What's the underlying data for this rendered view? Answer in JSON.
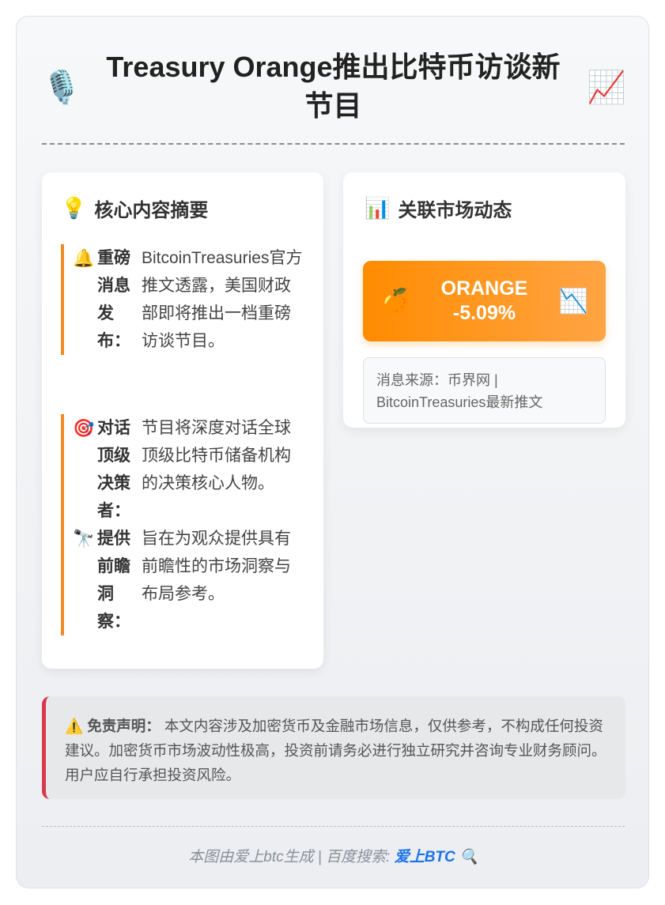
{
  "header": {
    "left_icon": "microphone-icon",
    "left_glyph": "🎙️",
    "title": "Treasury Orange推出比特币访谈新节目",
    "right_icon": "chart-increasing-icon",
    "right_glyph": "📈"
  },
  "summary": {
    "icon": "lightbulb-icon",
    "glyph": "💡",
    "heading": "核心内容摘要",
    "points": [
      {
        "icon": "bell-icon",
        "glyph": "🔔",
        "label": "重磅消息发布：",
        "text": "BitcoinTreasuries官方推文透露，美国财政部即将推出一档重磅访谈节目。"
      },
      {
        "icon": "target-icon",
        "glyph": "🎯",
        "label": "对话顶级决策者：",
        "text": "节目将深度对话全球顶级比特币储备机构的决策核心人物。"
      },
      {
        "icon": "telescope-icon",
        "glyph": "🔭",
        "label": "提供前瞻洞察：",
        "text": "旨在为观众提供具有前瞻性的市场洞察与布局参考。"
      }
    ]
  },
  "market": {
    "icon": "bar-chart-icon",
    "glyph": "📊",
    "heading": "关联市场动态",
    "ticker": {
      "left_icon": "orange-icon",
      "left_glyph": "🍊",
      "symbol": "ORANGE",
      "change": "-5.09%",
      "right_icon": "chart-decreasing-icon",
      "right_glyph": "📉"
    },
    "source": "消息来源：币界网 | BitcoinTreasuries最新推文"
  },
  "disclaimer": {
    "icon": "warning-icon",
    "glyph": "⚠️",
    "label": "免责声明：",
    "text": "本文内容涉及加密货币及金融市场信息，仅供参考，不构成任何投资建议。加密货币市场波动性极高，投资前请务必进行独立研究并咨询专业财务顾问。用户应自行承担投资风险。"
  },
  "footer": {
    "prefix": "本图由爱上btc生成 | 百度搜索: ",
    "brand": "爱上BTC",
    "icon": "magnifier-icon",
    "glyph": "🔍"
  },
  "colors": {
    "accent": "#f08a24",
    "ticker_start": "#ff8c00",
    "ticker_end": "#ffa444",
    "disclaimer_border": "#d6394c",
    "brand_link": "#1a73e8"
  }
}
